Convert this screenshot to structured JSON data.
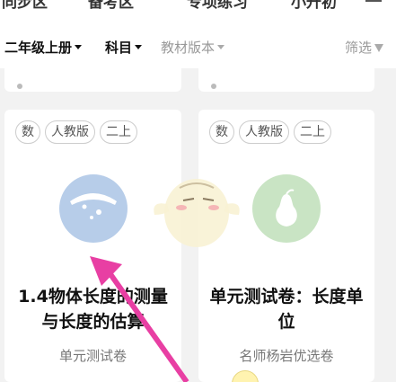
{
  "top_tabs": [
    "同步区",
    "备考区",
    "专项练习",
    "小升初"
  ],
  "filters": {
    "grade": "二年级上册",
    "subject": "科目",
    "edition": "教材版本",
    "filter_btn": "筛选"
  },
  "cards": [
    {
      "tags": [
        "数",
        "人教版",
        "二上"
      ],
      "title": "1.4物体长度的测量与长度的估算",
      "subtitle": "单元测试卷",
      "cover_color": "#b7cde9"
    },
    {
      "tags": [
        "数",
        "人教版",
        "二上"
      ],
      "title": "单元测试卷：长度单位",
      "subtitle": "名师杨岩优选卷",
      "cover_color": "#c9e4c4"
    }
  ],
  "colors": {
    "annotation_arrow": "#e83fa3",
    "page_bg": "#f2f2f2"
  }
}
